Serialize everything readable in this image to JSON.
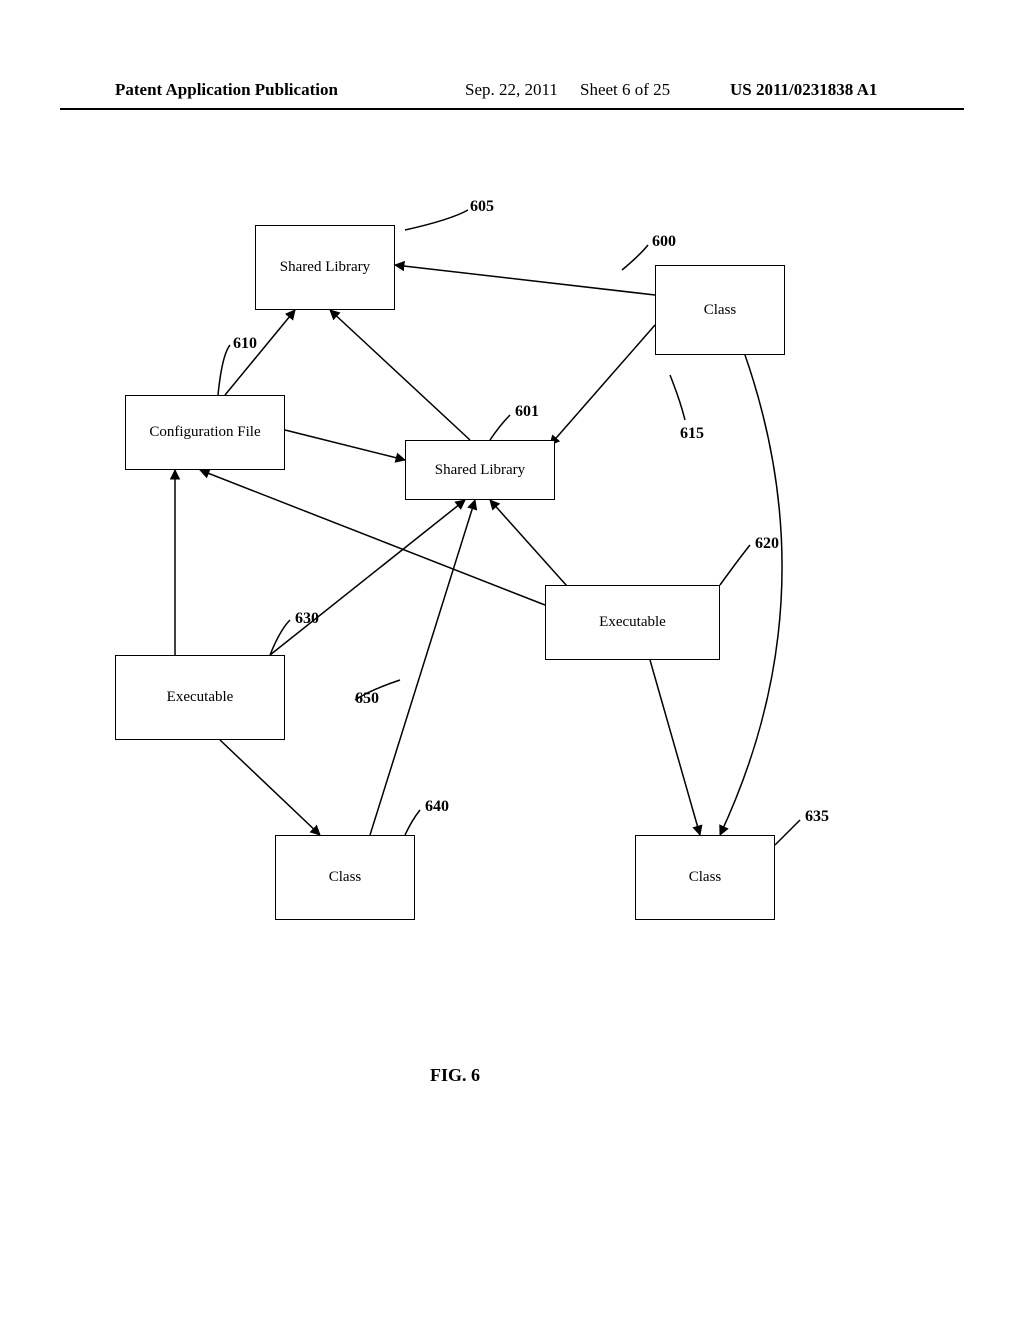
{
  "header": {
    "left": "Patent Application Publication",
    "date": "Sep. 22, 2011",
    "sheet": "Sheet 6 of 25",
    "pubno": "US 2011/0231838 A1"
  },
  "figure": {
    "label": "FIG. 6"
  },
  "nodes": {
    "n600": {
      "label": "Class",
      "ref": "600"
    },
    "n601": {
      "label": "Shared Library",
      "ref": "601"
    },
    "n605": {
      "label": "Shared Library",
      "ref": "605"
    },
    "n610": {
      "label": "Configuration File",
      "ref": "610"
    },
    "n615": {
      "label": "",
      "ref": "615"
    },
    "n620": {
      "label": "Executable",
      "ref": "620"
    },
    "n630": {
      "label": "Executable",
      "ref": "630"
    },
    "n635": {
      "label": "Class",
      "ref": "635"
    },
    "n640": {
      "label": "Class",
      "ref": "640"
    },
    "n650": {
      "label": "",
      "ref": "650"
    }
  }
}
